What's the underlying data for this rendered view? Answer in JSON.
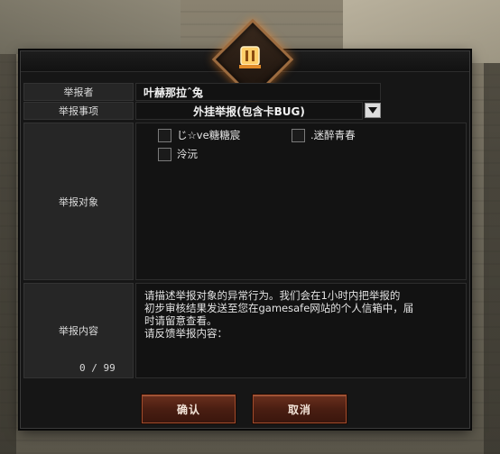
{
  "form": {
    "reporter_label": "举报者",
    "reporter_value": "叶赫那拉ˆ兔",
    "type_label": "举报事项",
    "type_value": "外挂举报(包含卡BUG)",
    "targets_label": "举报对象",
    "targets": [
      {
        "name": "じ☆ve糖糖宸",
        "checked": false
      },
      {
        "name": ".迷醉青春",
        "checked": false
      },
      {
        "name": "泠沅",
        "checked": false
      }
    ],
    "content_label": "举报内容",
    "description": "请描述举报对象的异常行为。我们会在1小时内把举报的\n初步审核结果发送至您在gamesafe网站的个人信箱中，届\n时请留意查看。\n请反馈举报内容：",
    "counter": "0 / 99"
  },
  "buttons": {
    "confirm": "确认",
    "cancel": "取消"
  },
  "colors": {
    "accent": "#a24c2c",
    "emblem_glow": "#ffb347"
  }
}
